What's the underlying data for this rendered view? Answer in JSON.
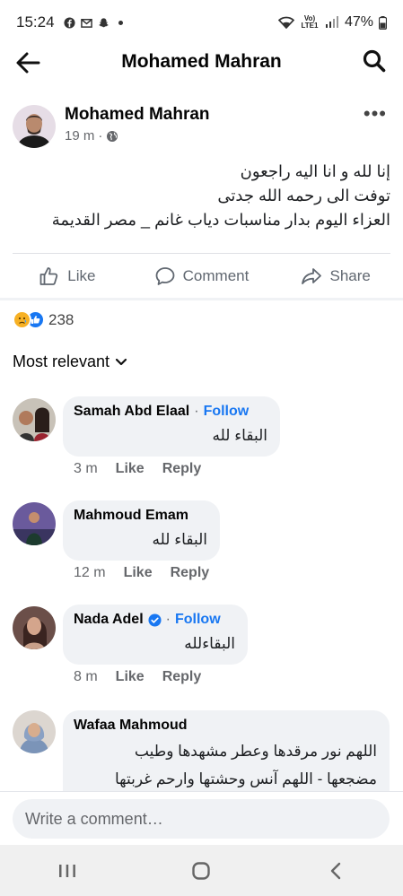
{
  "status_bar": {
    "time": "15:24",
    "battery": "47%",
    "network": "Vo) LTE1"
  },
  "header": {
    "title": "Mohamed Mahran"
  },
  "post": {
    "author": "Mohamed Mahran",
    "time": "19 m",
    "lines": [
      "إنا لله و انا اليه راجعون",
      "توفت الى رحمه الله جدتى",
      "العزاء اليوم بدار مناسبات دياب غانم _ مصر القديمة"
    ],
    "actions": {
      "like": "Like",
      "comment": "Comment",
      "share": "Share"
    },
    "reaction_count": "238"
  },
  "sort_label": "Most relevant",
  "comments": [
    {
      "name": "Samah Abd Elaal",
      "follow": "Follow",
      "text": [
        "البقاء لله"
      ],
      "time": "3 m",
      "like": "Like",
      "reply": "Reply"
    },
    {
      "name": "Mahmoud Emam",
      "text": [
        "البقاء لله"
      ],
      "time": "12 m",
      "like": "Like",
      "reply": "Reply"
    },
    {
      "name": "Nada Adel",
      "verified": true,
      "follow": "Follow",
      "text": [
        "البقاءلله"
      ],
      "time": "8 m",
      "like": "Like",
      "reply": "Reply"
    },
    {
      "name": "Wafaa Mahmoud",
      "text": [
        "اللهم نور مرقدها وعطر مشهدها وطيب",
        "مضجعها - اللهم آنس وحشتها وارحم غربتها"
      ]
    }
  ],
  "composer": {
    "placeholder": "Write a comment…"
  },
  "colors": {
    "accent": "#1877f2",
    "bubble": "#f0f2f5",
    "secondary_text": "#65676b"
  }
}
